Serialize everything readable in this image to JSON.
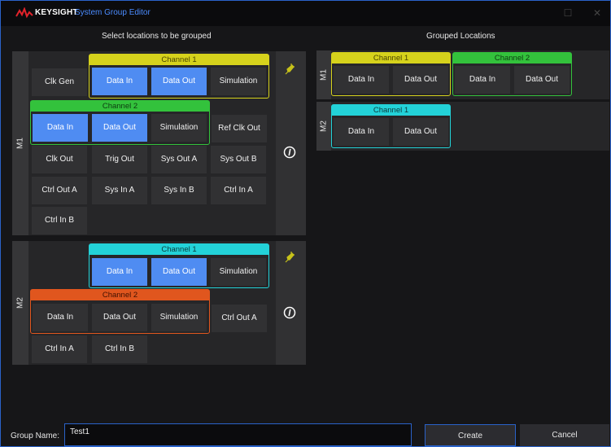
{
  "window": {
    "brand": "KEYSIGHT",
    "title": "System Group Editor",
    "maximize_glyph": "☐",
    "close_glyph": "✕"
  },
  "left_caption": "Select locations to be grouped",
  "right_caption": "Grouped Locations",
  "modules": {
    "m1": {
      "label": "M1",
      "standalone": {
        "clk_gen": "Clk Gen",
        "ref_clk_out": "Ref Clk Out",
        "clk_out": "Clk Out",
        "trig_out": "Trig Out",
        "sys_out_a": "Sys Out A",
        "sys_out_b": "Sys Out B",
        "ctrl_out_a": "Ctrl Out A",
        "sys_in_a": "Sys In A",
        "sys_in_b": "Sys In B",
        "ctrl_in_a": "Ctrl In A",
        "ctrl_in_b": "Ctrl In B"
      },
      "channel1": {
        "title": "Channel 1",
        "data_in": "Data In",
        "data_out": "Data Out",
        "simulation": "Simulation"
      },
      "channel2": {
        "title": "Channel 2",
        "data_in": "Data In",
        "data_out": "Data Out",
        "simulation": "Simulation"
      }
    },
    "m2": {
      "label": "M2",
      "standalone": {
        "ctrl_out_a": "Ctrl Out A",
        "ctrl_in_a": "Ctrl In A",
        "ctrl_in_b": "Ctrl In B"
      },
      "channel1": {
        "title": "Channel 1",
        "data_in": "Data In",
        "data_out": "Data Out",
        "simulation": "Simulation"
      },
      "channel2": {
        "title": "Channel 2",
        "data_in": "Data In",
        "data_out": "Data Out",
        "simulation": "Simulation"
      }
    }
  },
  "grouped": {
    "m1": {
      "label": "M1",
      "channel1": {
        "title": "Channel 1",
        "data_in": "Data In",
        "data_out": "Data Out"
      },
      "channel2": {
        "title": "Channel 2",
        "data_in": "Data In",
        "data_out": "Data Out"
      }
    },
    "m2": {
      "label": "M2",
      "channel1": {
        "title": "Channel 1",
        "data_in": "Data In",
        "data_out": "Data Out"
      }
    }
  },
  "footer": {
    "group_name_label": "Group Name:",
    "group_name_value": "Test1",
    "create_label": "Create",
    "cancel_label": "Cancel"
  },
  "colors": {
    "accent": "#2a62c9",
    "selected": "#4f8cf2",
    "channel_yellow": "#d6d21c",
    "channel_green": "#33c23c",
    "channel_cyan": "#23d2d8",
    "channel_orange": "#e0561e"
  },
  "icons": [
    "keysight-logo-icon",
    "plug-icon",
    "info-icon",
    "maximize-icon",
    "close-icon"
  ]
}
